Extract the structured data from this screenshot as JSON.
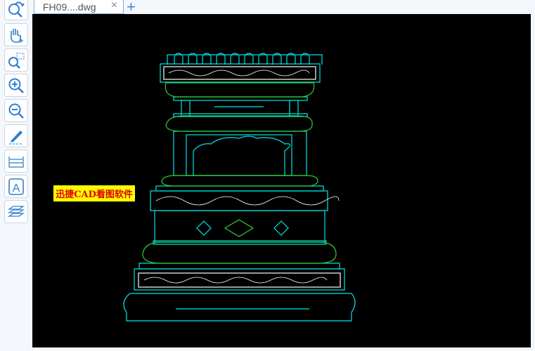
{
  "tab": {
    "title": "FH09....dwg",
    "close": "×",
    "new_tab": "+"
  },
  "toolbar": [
    "undo-view",
    "pan",
    "zoom-window",
    "zoom-in",
    "zoom-out",
    "markup",
    "measure",
    "text",
    "layers"
  ],
  "annotation": {
    "text": "迅捷CAD看图软件"
  },
  "colors": {
    "cyan": "#00e5e5",
    "green": "#33cc33",
    "white": "#ffffff",
    "label_bg": "#ffff00",
    "label_fg": "#e00000"
  }
}
